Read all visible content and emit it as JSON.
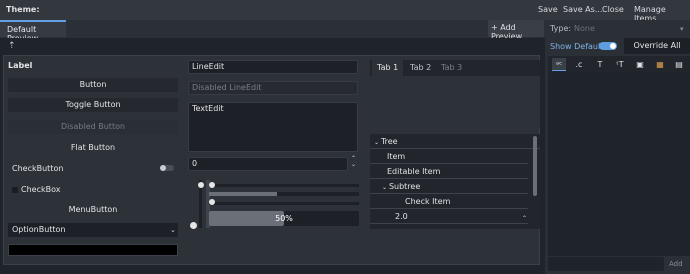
{
  "topbar": {
    "title": "Theme:",
    "save": "Save",
    "save_as": "Save As...",
    "close": "Close",
    "manage": "Manage Items..."
  },
  "tabs": {
    "default_preview": "Default Preview"
  },
  "toolbar": {
    "add_preview": "+ Add Preview",
    "type_label": "Type:",
    "type_value": "None"
  },
  "right": {
    "show_default": "Show Default",
    "override_all": "Override All",
    "add": "Add",
    "icons": [
      "ab",
      "c",
      "T",
      "f",
      "img",
      "grid",
      "box"
    ]
  },
  "preview": {
    "label": "Label",
    "button": "Button",
    "toggle_button": "Toggle Button",
    "disabled_button": "Disabled Button",
    "flat_button": "Flat Button",
    "check_button": "CheckButton",
    "check_box": "CheckBox",
    "menu_button": "MenuButton",
    "option_button": "OptionButton",
    "line_edit": "LineEdit",
    "disabled_line_edit": "Disabled LineEdit",
    "text_edit": "TextEdit",
    "spin_value": "0",
    "progress": "50%",
    "tab1": "Tab 1",
    "tab2": "Tab 2",
    "tab3": "Tab 3",
    "tree": [
      "Tree",
      "Item",
      "Editable Item",
      "Subtree",
      "Check Item",
      "2.0"
    ]
  }
}
